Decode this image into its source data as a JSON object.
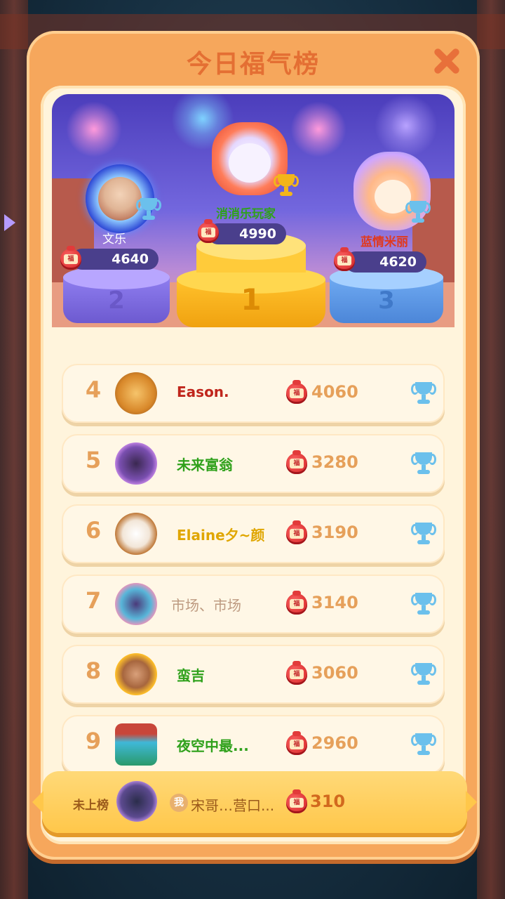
{
  "title": "今日福气榜",
  "bag_char": "福",
  "top3": {
    "first": {
      "rank": "1",
      "name": "消消乐玩家",
      "score": "4990"
    },
    "second": {
      "rank": "2",
      "name": "文乐",
      "score": "4640"
    },
    "third": {
      "rank": "3",
      "name": "蓝情米丽",
      "score": "4620"
    }
  },
  "rows": [
    {
      "rank": "4",
      "name": "Eason.",
      "score": "4060"
    },
    {
      "rank": "5",
      "name": "未来富翁",
      "score": "3280"
    },
    {
      "rank": "6",
      "name": "Elaine夕~颜",
      "score": "3190"
    },
    {
      "rank": "7",
      "name": "市场、市场",
      "score": "3140"
    },
    {
      "rank": "8",
      "name": "蛮吉",
      "score": "3060"
    },
    {
      "rank": "9",
      "name": "夜空中最...",
      "score": "2960"
    }
  ],
  "me": {
    "status": "未上榜",
    "tag": "我",
    "name": "宋哥…营口...",
    "score": "310"
  },
  "colors": {
    "panel": "#f6a75c",
    "title": "#e46f33",
    "rank_text": "#e6a05a",
    "name_red": "#c0261c",
    "name_green": "#2fa11b"
  },
  "icons": [
    "close-icon",
    "fu-bag-icon",
    "trophy-icon",
    "crown-laurel-icon"
  ]
}
